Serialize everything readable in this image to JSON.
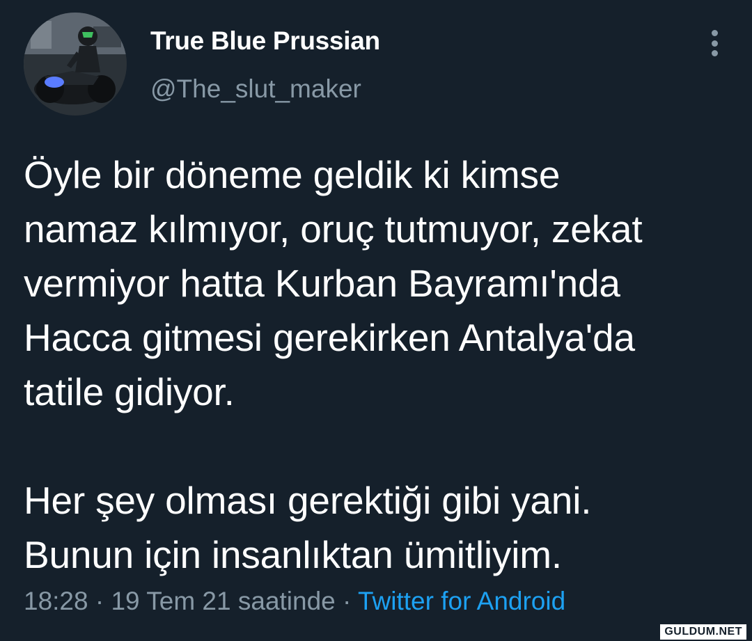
{
  "user": {
    "display_name": "True Blue Prussian",
    "handle": "@The_slut_maker",
    "avatar_icon": "avatar-motorcycle-rider"
  },
  "tweet": {
    "lines_paragraph_1": [
      "Öyle bir döneme geldik ki kimse",
      "namaz kılmıyor, oruç tutmuyor, zekat",
      "vermiyor hatta Kurban Bayramı'nda",
      "Hacca gitmesi gerekirken Antalya'da",
      "tatile gidiyor."
    ],
    "lines_paragraph_2": [
      "Her şey olması gerektiği gibi yani.",
      "Bunun için insanlıktan ümitliyim."
    ]
  },
  "meta": {
    "time": "18:28",
    "separator": " · ",
    "date": "19 Tem 21 saatinde",
    "source": "Twitter for Android"
  },
  "watermark": "GULDUM.NET",
  "colors": {
    "background": "#15202b",
    "secondary_text": "#8899a6",
    "accent": "#1da1f2"
  }
}
